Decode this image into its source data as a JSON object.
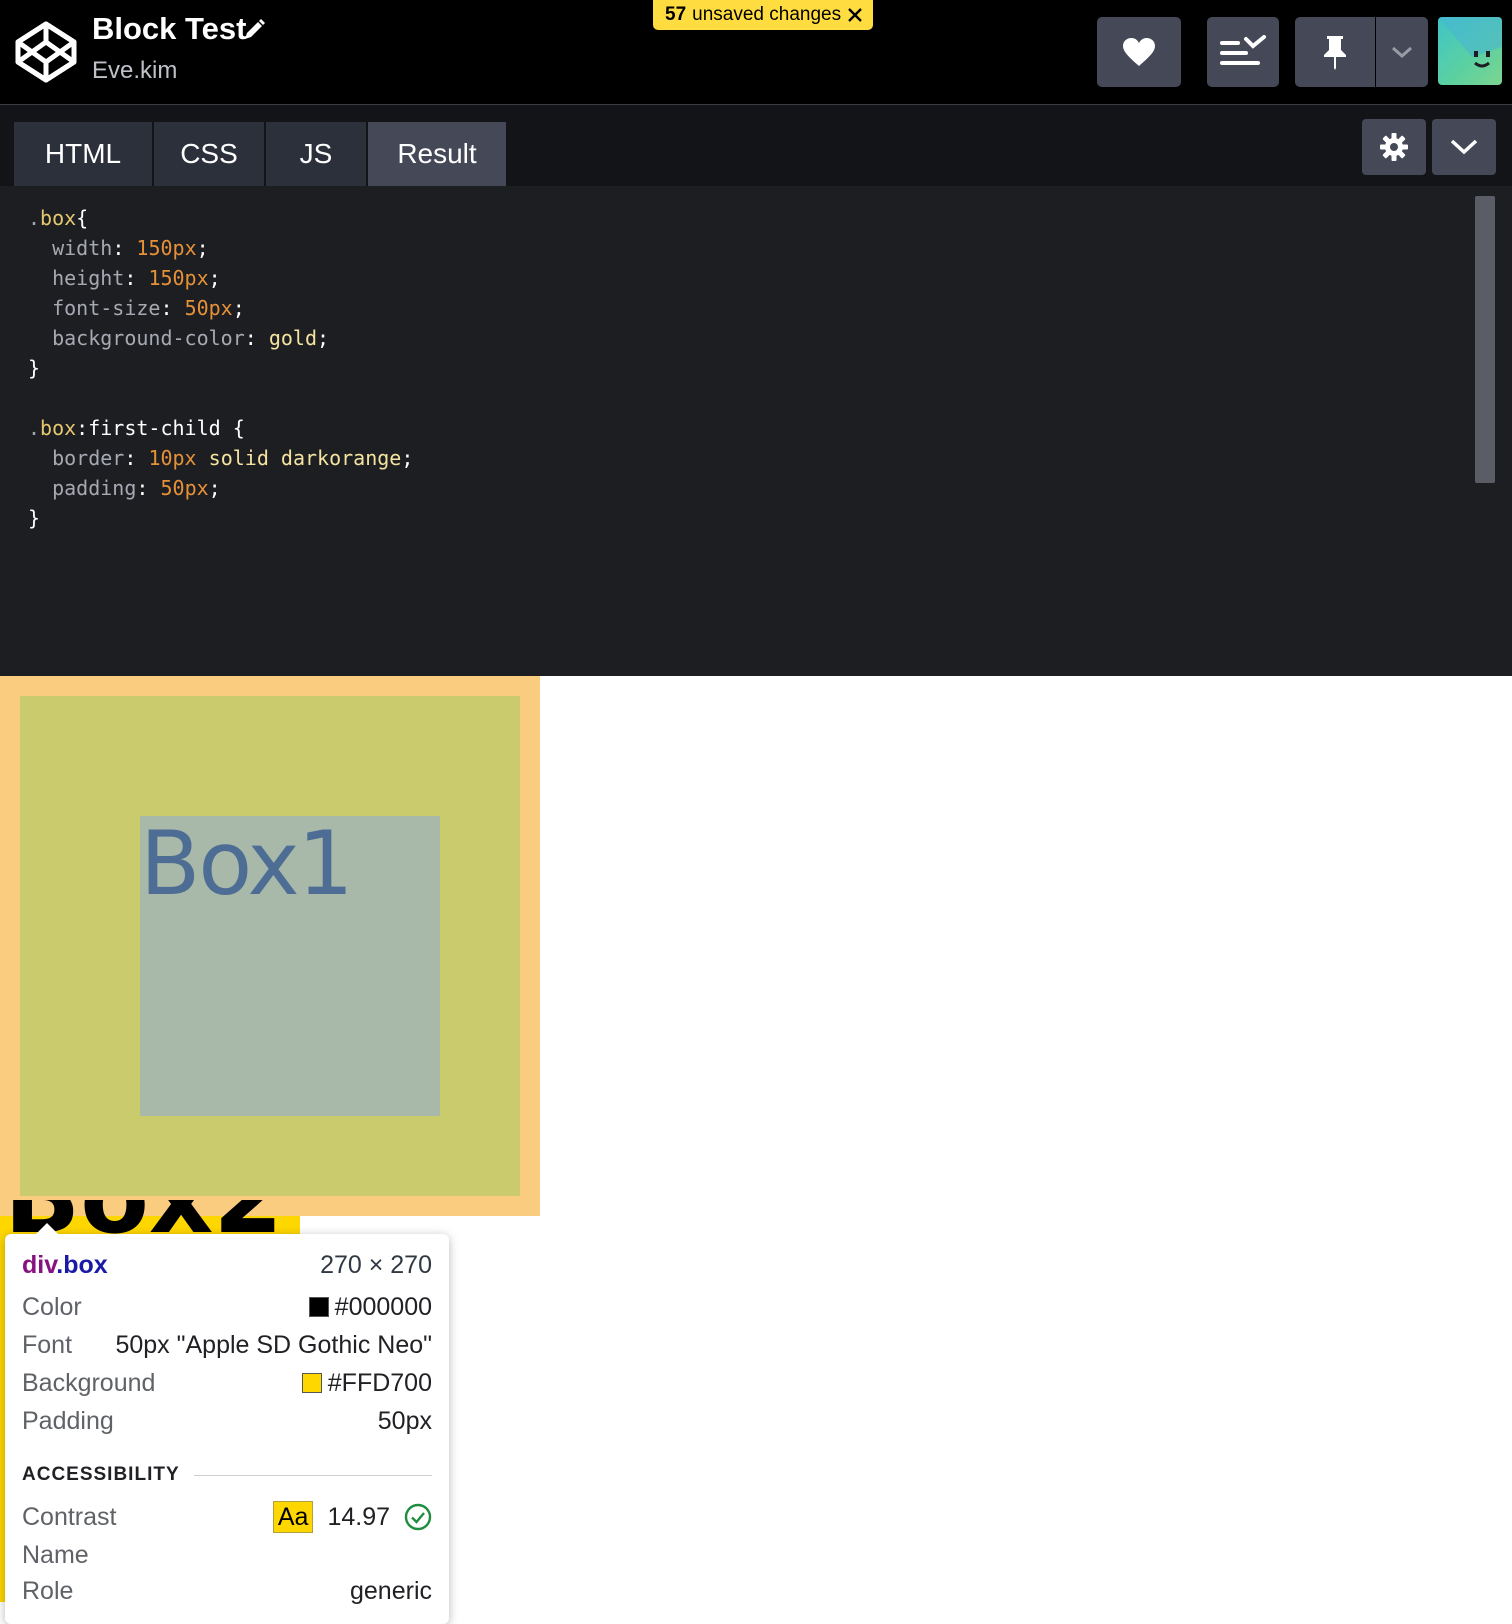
{
  "header": {
    "app_logo": "codepen-logo",
    "title": "Block Test",
    "edit_icon": "pencil-icon",
    "author": "Eve.kim",
    "unsaved": {
      "count": "57",
      "label": "unsaved changes"
    },
    "buttons": [
      "heart-icon",
      "view-options-icon",
      "pin-icon",
      "chevron-down-icon"
    ]
  },
  "editor": {
    "tabs": [
      {
        "label": "HTML"
      },
      {
        "label": "CSS"
      },
      {
        "label": "JS"
      },
      {
        "label": "Result"
      }
    ],
    "active_tab": "CSS",
    "code_lines": [
      ".box{",
      "  width: 150px;",
      "  height: 150px;",
      "  font-size: 50px;",
      "  background-color: gold;",
      "}",
      "",
      ".box:first-child {",
      "  border: 10px solid darkorange;",
      "  padding: 50px;",
      "}"
    ]
  },
  "result": {
    "box1_text": "Box1",
    "box2_text": "Box2",
    "colors": {
      "margin_overlay": "#f9cc80",
      "border_overlay": "#c9cb6c",
      "content_overlay": "#a8b9a9",
      "gold": "#ffd700"
    }
  },
  "inspector": {
    "tag": "div",
    "class": ".box",
    "dims": "270 × 270",
    "rows": [
      {
        "label": "Color",
        "value": "#000000",
        "swatch": "#000000"
      },
      {
        "label": "Font",
        "value": "50px \"Apple SD Gothic Neo\""
      },
      {
        "label": "Background",
        "value": "#FFD700",
        "swatch": "#FFD700"
      },
      {
        "label": "Padding",
        "value": "50px"
      }
    ],
    "accessibility_heading": "ACCESSIBILITY",
    "contrast": {
      "label": "Contrast",
      "badge": "Aa",
      "value": "14.97"
    },
    "name": {
      "label": "Name",
      "value": ""
    },
    "role": {
      "label": "Role",
      "value": "generic"
    }
  }
}
